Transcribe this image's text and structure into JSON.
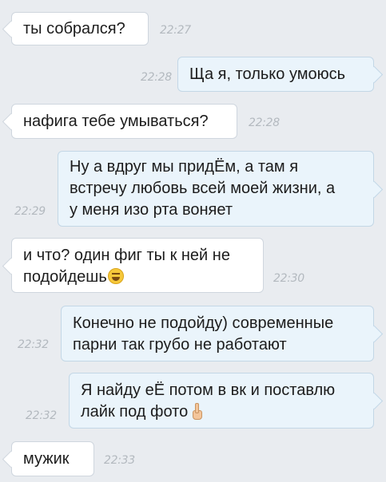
{
  "messages": [
    {
      "dir": "in",
      "text": "ты собрался?",
      "time": "22:27"
    },
    {
      "dir": "out",
      "text": "Ща я, только умоюсь",
      "time": "22:28"
    },
    {
      "dir": "in",
      "text": "нафига тебе умываться?",
      "time": "22:28"
    },
    {
      "dir": "out",
      "text": "Ну а вдруг мы придЁм, а там я\nвстречу любовь всей моей жизни, а\nу меня изо рта воняет",
      "time": "22:29"
    },
    {
      "dir": "in",
      "text": "и что? один фиг ты к ней не\nподойдешь",
      "emoji": "laughing-face",
      "time": "22:30"
    },
    {
      "dir": "out",
      "text": "Конечно не подойду) современные\nпарни так грубо не работают",
      "time": "22:32"
    },
    {
      "dir": "out",
      "text": "Я найду еЁ потом в вк и поставлю\nлайк под фото",
      "emoji": "pointing-up-hand",
      "time": "22:32"
    },
    {
      "dir": "in",
      "text": "мужик",
      "time": "22:33"
    }
  ],
  "colors": {
    "background": "#e9ecf0",
    "incoming_bubble": "#ffffff",
    "outgoing_bubble": "#eaf4fb",
    "timestamp": "#b3b9bf"
  }
}
